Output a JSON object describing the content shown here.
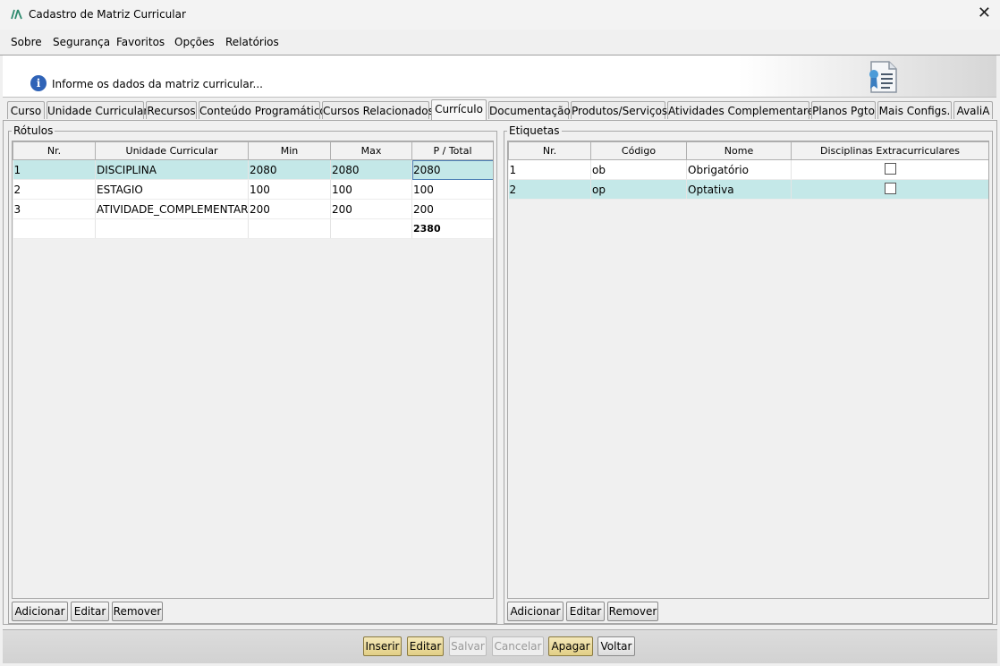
{
  "window": {
    "title": "Cadastro de Matriz Curricular",
    "close_glyph": "✕"
  },
  "menu": [
    {
      "label": "Sobre"
    },
    {
      "label": "Segurança"
    },
    {
      "label": "Favoritos"
    },
    {
      "label": "Opções"
    },
    {
      "label": "Relatórios"
    }
  ],
  "info": {
    "icon": "info-icon",
    "text": "Informe os dados da matriz curricular...",
    "right_icon": "certificate-document-icon"
  },
  "tabs": [
    {
      "label": "Curso"
    },
    {
      "label": "Unidade Curricular"
    },
    {
      "label": "Recursos"
    },
    {
      "label": "Conteúdo Programático"
    },
    {
      "label": "Cursos Relacionados"
    },
    {
      "label": "Currículo",
      "active": true
    },
    {
      "label": "Documentação"
    },
    {
      "label": "Produtos/Serviços"
    },
    {
      "label": "Atividades Complementares"
    },
    {
      "label": "Planos Pgto"
    },
    {
      "label": "Mais Configs."
    },
    {
      "label": "AvaliA"
    }
  ],
  "rotulos": {
    "legend": "Rótulos",
    "columns": [
      "Nr.",
      "Unidade Curricular",
      "Min",
      "Max",
      "P / Total"
    ],
    "rows": [
      {
        "nr": "1",
        "unidade": "DISCIPLINA",
        "min": "2080",
        "max": "2080",
        "total": "2080"
      },
      {
        "nr": "2",
        "unidade": "ESTAGIO",
        "min": "100",
        "max": "100",
        "total": "100"
      },
      {
        "nr": "3",
        "unidade": "ATIVIDADE_COMPLEMENTAR",
        "min": "200",
        "max": "200",
        "total": "200"
      }
    ],
    "grand_total": "2380",
    "buttons": {
      "add": "Adicionar",
      "edit": "Editar",
      "remove": "Remover"
    }
  },
  "etiquetas": {
    "legend": "Etiquetas",
    "columns": [
      "Nr.",
      "Código",
      "Nome",
      "Disciplinas Extracurriculares"
    ],
    "rows": [
      {
        "nr": "1",
        "codigo": "ob",
        "nome": "Obrigatório",
        "extra": false
      },
      {
        "nr": "2",
        "codigo": "op",
        "nome": "Optativa",
        "extra": false
      }
    ],
    "buttons": {
      "add": "Adicionar",
      "edit": "Editar",
      "remove": "Remover"
    }
  },
  "actions": {
    "insert": "Inserir",
    "edit": "Editar",
    "save": "Salvar",
    "cancel": "Cancelar",
    "delete": "Apagar",
    "back": "Voltar"
  }
}
